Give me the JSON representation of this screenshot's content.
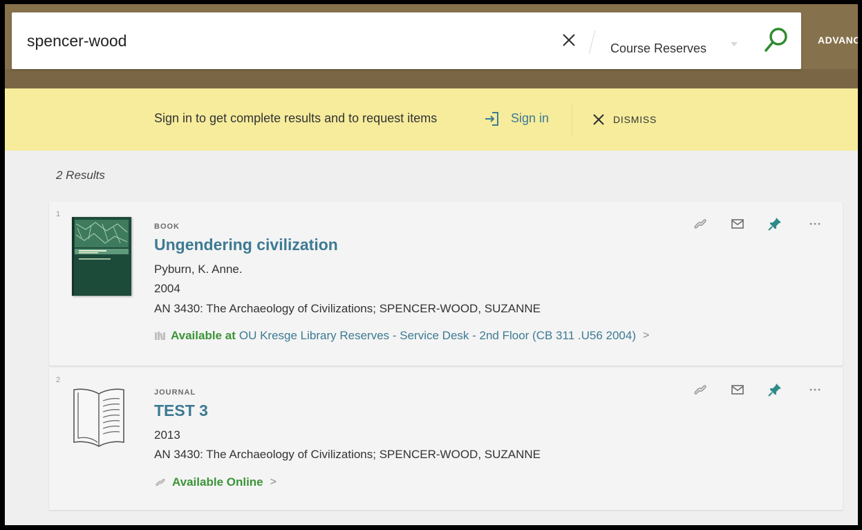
{
  "search": {
    "query": "spencer-wood",
    "scope": "Course Reserves",
    "advanced_label": "ADVANCED SEARCH"
  },
  "signin_bar": {
    "message": "Sign in to get complete results and to request items",
    "signin_label": "Sign in",
    "dismiss_label": "DISMISS"
  },
  "results": {
    "count_label": "2 Results",
    "items": [
      {
        "index": "1",
        "type": "BOOK",
        "title": "Ungendering civilization",
        "author": "Pyburn, K. Anne.",
        "year": "2004",
        "course": "AN 3430: The Archaeology of Civilizations; SPENCER-WOOD, SUZANNE",
        "availability_status": "Available at",
        "availability_location": "OU Kresge Library  Reserves - Service Desk - 2nd Floor (CB 311 .U56 2004)",
        "availability_chevron": ">"
      },
      {
        "index": "2",
        "type": "JOURNAL",
        "title": "TEST 3",
        "year": "2013",
        "course": "AN 3430: The Archaeology of Civilizations; SPENCER-WOOD, SUZANNE",
        "availability_status": "Available Online",
        "availability_chevron": ">"
      }
    ]
  },
  "colors": {
    "header_brown": "#86714d",
    "signin_yellow": "#f6ec9c",
    "link_blue": "#3d7a93",
    "available_green": "#3c9438",
    "search_icon_green": "#2f8b2f",
    "pin_teal": "#2f8a8a"
  },
  "icons": {
    "clear": "close-icon",
    "search": "magnifier-icon",
    "signin": "sign-in-icon",
    "dismiss": "close-icon",
    "link": "link-icon",
    "email": "envelope-icon",
    "pin": "pin-icon",
    "more": "more-icon",
    "physical": "book-shelf-icon",
    "online": "link-icon"
  }
}
